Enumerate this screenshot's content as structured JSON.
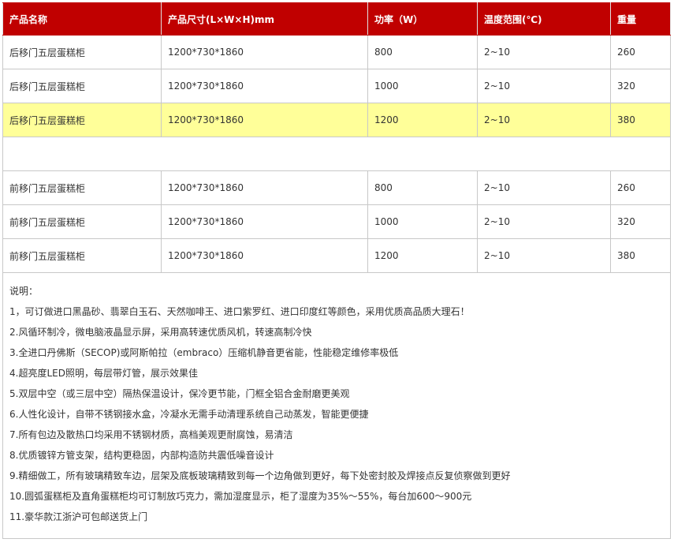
{
  "headers": [
    "产品名称",
    "产品尺寸(L×W×H)mm",
    "功率（W）",
    "温度范围(℃)",
    "重量"
  ],
  "group1": [
    [
      "后移门五层蛋糕柜",
      "1200*730*1860",
      "800",
      "2~10",
      "260"
    ],
    [
      "后移门五层蛋糕柜",
      "1200*730*1860",
      "1000",
      "2~10",
      "320"
    ],
    [
      "后移门五层蛋糕柜",
      "1200*730*1860",
      "1200",
      "2~10",
      "380"
    ]
  ],
  "group2": [
    [
      "前移门五层蛋糕柜",
      "1200*730*1860",
      "800",
      "2~10",
      "260"
    ],
    [
      "前移门五层蛋糕柜",
      "1200*730*1860",
      "1000",
      "2~10",
      "320"
    ],
    [
      "前移门五层蛋糕柜",
      "1200*730*1860",
      "1200",
      "2~10",
      "380"
    ]
  ],
  "highlight_color": "#ffff99",
  "header_color": "#c00000",
  "notes_title": "说明：",
  "notes": [
    "1，可订做进口黑晶砂、翡翠白玉石、天然咖啡王、进口紫罗红、进口印度红等颜色，采用优质高品质大理石！",
    "2.风循环制冷，微电脑液晶显示屏，采用高转速优质风机，转速高制冷快",
    "3.全进口丹佛斯（SECOP)或阿斯帕拉（embraco）压缩机静音更省能，性能稳定维修率极低",
    "4.超亮度LED照明，每层带灯管，展示效果佳",
    "5.双层中空（或三层中空）隔热保温设计，保冷更节能，门框全铝合金耐磨更美观",
    "6.人性化设计，自带不锈钢接水盒，冷凝水无需手动清理系统自己动蒸发，智能更便捷",
    "7.所有包边及散热口均采用不锈钢材质，高档美观更耐腐蚀，易清洁",
    "8.优质镀锌方管支架，结构更稳固，内部构造防共震低噪音设计",
    "9.精细做工，所有玻璃精致车边，层架及底板玻璃精致到每一个边角做到更好，每下处密封胶及焊接点反复侦察做到更好",
    "10.圆弧蛋糕柜及直角蛋糕柜均可订制放巧克力，需加湿度显示，柜了湿度为35%～55%，每台加600～900元",
    "11.豪华款江浙沪可包邮送货上门"
  ]
}
